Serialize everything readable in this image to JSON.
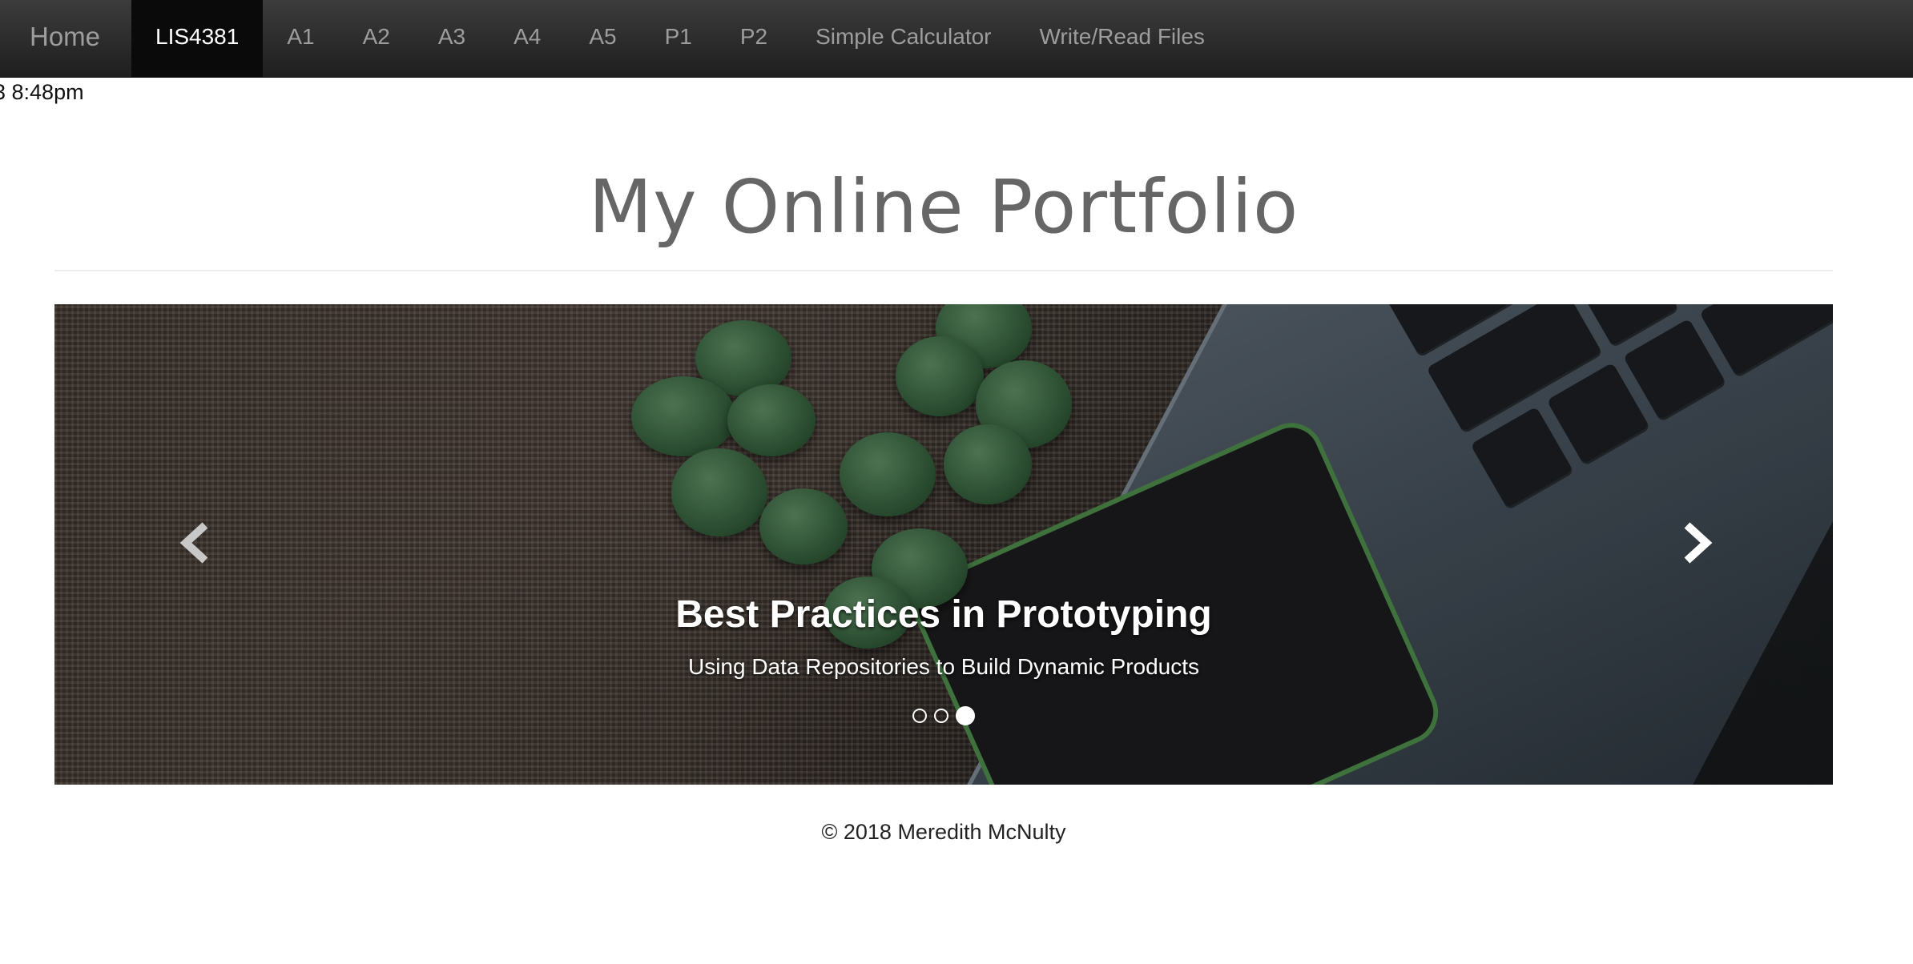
{
  "navbar": {
    "brand": "Home",
    "items": [
      {
        "label": "LIS4381",
        "active": true
      },
      {
        "label": "A1"
      },
      {
        "label": "A2"
      },
      {
        "label": "A3"
      },
      {
        "label": "A4"
      },
      {
        "label": "A5"
      },
      {
        "label": "P1"
      },
      {
        "label": "P2"
      },
      {
        "label": "Simple Calculator"
      },
      {
        "label": "Write/Read Files"
      }
    ]
  },
  "timestamp": "3 8:48pm",
  "page": {
    "title": "My Online Portfolio"
  },
  "carousel": {
    "active_slide": 3,
    "slide_count": 3,
    "caption_title": "Best Practices in Prototyping",
    "caption_subtitle": "Using Data Repositories to Build Dynamic Products",
    "prev_icon": "chevron-left-icon",
    "next_icon": "chevron-right-icon"
  },
  "footer": {
    "text": "© 2018 Meredith McNulty"
  },
  "colors": {
    "navbar": "#222222",
    "nav_active": "#0a0a0a",
    "nav_text": "#9d9d9d",
    "title": "#666666"
  }
}
